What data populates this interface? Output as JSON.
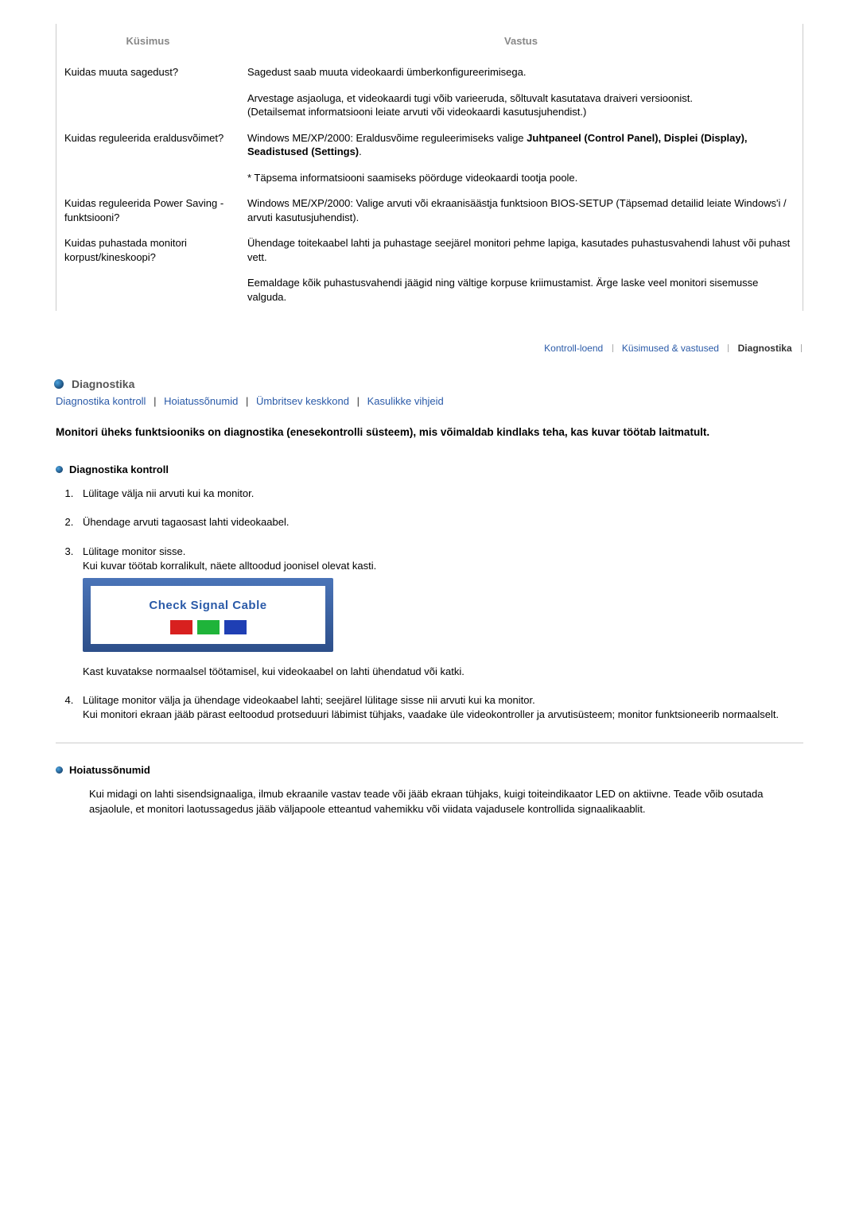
{
  "table": {
    "headers": {
      "q": "Küsimus",
      "a": "Vastus"
    },
    "rows": [
      {
        "q": "Kuidas muuta sagedust?",
        "a": "Sagedust saab muuta videokaardi ümberkonfigureerimisega."
      },
      {
        "q": "",
        "a": "Arvestage asjaoluga, et videokaardi tugi võib varieeruda, sõltuvalt kasutatava draiveri versioonist.\n(Detailsemat informatsiooni leiate arvuti või videokaardi kasutusjuhendist.)"
      },
      {
        "q": "Kuidas reguleerida eraldusvõimet?",
        "a_pre": "Windows ME/XP/2000: Eraldusvõime reguleerimiseks valige ",
        "a_bold": "Juhtpaneel (Control Panel), Displei (Display), Seadistused (Settings)",
        "a_post": "."
      },
      {
        "q": "",
        "a": "* Täpsema informatsiooni saamiseks pöörduge videokaardi tootja poole."
      },
      {
        "q": "Kuidas reguleerida Power Saving -funktsiooni?",
        "a": "Windows ME/XP/2000: Valige arvuti või ekraanisäästja funktsioon BIOS-SETUP (Täpsemad detailid leiate Windows'i / arvuti kasutusjuhendist)."
      },
      {
        "q": "Kuidas puhastada monitori korpust/kineskoopi?",
        "a": "Ühendage toitekaabel lahti ja puhastage seejärel monitori pehme lapiga, kasutades puhastusvahendi lahust või puhast vett."
      },
      {
        "q": "",
        "a": "Eemaldage kõik puhastusvahendi jäägid ning vältige korpuse kriimustamist. Ärge laske veel monitori sisemusse valguda."
      }
    ]
  },
  "subnav": {
    "items": [
      {
        "label": "Kontroll-loend",
        "current": false
      },
      {
        "label": "Küsimused & vastused",
        "current": false
      },
      {
        "label": "Diagnostika",
        "current": true
      }
    ]
  },
  "section": {
    "title": "Diagnostika",
    "links": [
      "Diagnostika kontroll",
      "Hoiatussõnumid",
      "Ümbritsev keskkond",
      "Kasulikke vihjeid"
    ],
    "intro": "Monitori üheks funktsiooniks on diagnostika (enesekontrolli süsteem), mis võimaldab kindlaks teha, kas kuvar töötab laitmatult."
  },
  "diag": {
    "title": "Diagnostika kontroll",
    "steps": {
      "s1": "Lülitage välja nii arvuti kui ka monitor.",
      "s2": "Ühendage arvuti tagaosast lahti videokaabel.",
      "s3a": "Lülitage monitor sisse.",
      "s3b": "Kui kuvar töötab korralikult, näete alltoodud joonisel olevat kasti.",
      "signal_label": "Check Signal Cable",
      "s3c": "Kast kuvatakse normaalsel töötamisel, kui videokaabel on lahti ühendatud või katki.",
      "s4a": "Lülitage monitor välja ja ühendage videokaabel lahti; seejärel lülitage sisse nii arvuti kui ka monitor.",
      "s4b": "Kui monitori ekraan jääb pärast eeltoodud protseduuri läbimist tühjaks, vaadake üle videokontroller ja arvutisüsteem; monitor funktsioneerib normaalselt."
    }
  },
  "warn": {
    "title": "Hoiatussõnumid",
    "body": "Kui midagi on lahti sisendsignaaliga, ilmub ekraanile vastav teade või jääb ekraan tühjaks, kuigi toiteindikaator LED on aktiivne. Teade võib osutada asjaolule, et monitori laotussagedus jääb väljapoole etteantud vahemikku või viidata vajadusele kontrollida signaalikaablit."
  }
}
